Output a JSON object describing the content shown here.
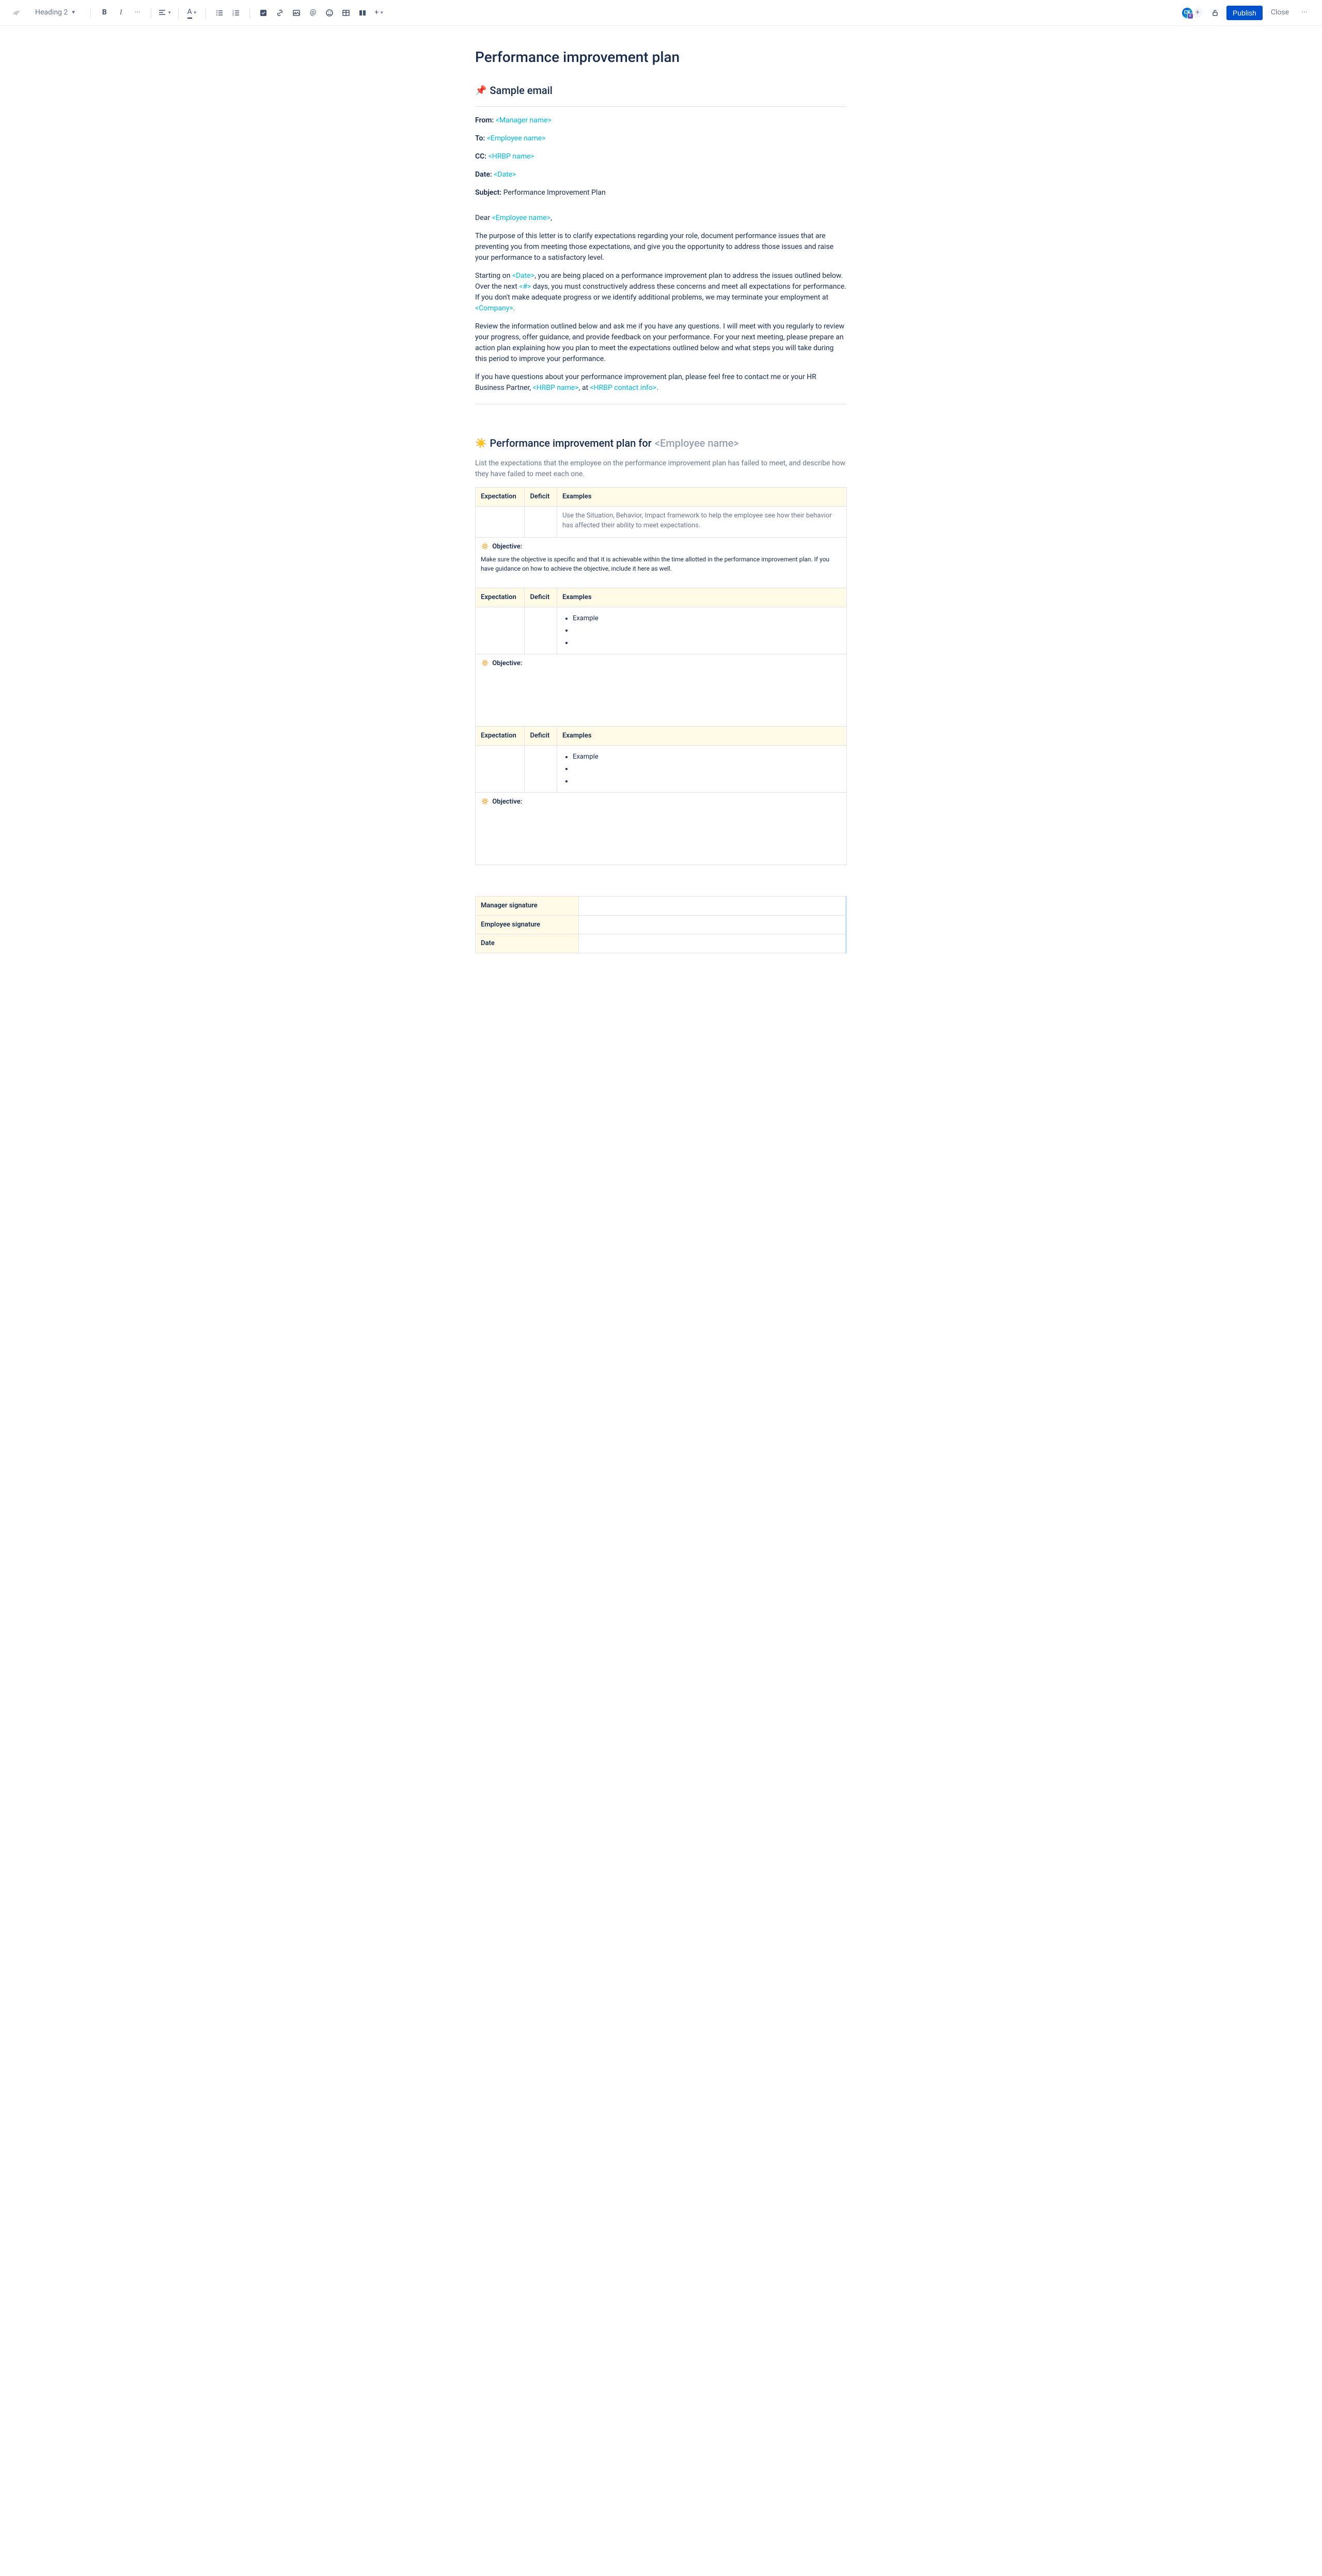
{
  "toolbar": {
    "style": "Heading 2",
    "publish": "Publish",
    "close": "Close",
    "avatar": "CK"
  },
  "title": "Performance improvement plan",
  "sample_email": {
    "heading": "Sample email",
    "from_label": "From:",
    "from_value": "<Manager name>",
    "to_label": "To:",
    "to_value": "<Employee name>",
    "cc_label": "CC:",
    "cc_value": "<HRBP name>",
    "date_label": "Date:",
    "date_value": "<Date>",
    "subject_label": "Subject:",
    "subject_value": "Performance Improvement Plan",
    "greeting_prefix": "Dear ",
    "greeting_name": "<Employee name>",
    "greeting_suffix": ",",
    "p1": "The purpose of this letter is to clarify expectations regarding your role, document performance issues that are preventing you from meeting those expectations, and give you the opportunity to address those issues and raise your performance to a satisfactory level.",
    "p2a": "Starting on ",
    "p2_date": "<Date>",
    "p2b": ", you are being placed on a performance improvement plan to address the issues outlined below. Over the next ",
    "p2_num": "<#>",
    "p2c": " days, you must constructively address these concerns and meet all expectations for performance. If you don't make adequate progress or we identify additional problems, we may terminate your employment at ",
    "p2_company": "<Company>",
    "p2d": ".",
    "p3": "Review the information outlined below and ask me if you have any questions. I will meet with you regularly to review your progress, offer guidance, and provide feedback on your performance. For your next meeting, please prepare an action plan explaining how you plan to meet the expectations outlined below and what steps you will take during this period to improve your performance.",
    "p4a": "If you have questions about your performance improvement plan, please feel free to contact me or your HR Business Partner, ",
    "p4_hrbp": "<HRBP name>",
    "p4b": ", at ",
    "p4_contact": "<HRBP contact info>",
    "p4c": "."
  },
  "pip": {
    "heading_prefix": "Performance improvement plan for ",
    "heading_name": "<Employee name>",
    "intro": "List the expectations that the employee on the performance improvement plan has failed to meet, and describe how they have failed to meet each one.",
    "th_expectation": "Expectation",
    "th_deficit": "Deficit",
    "th_examples": "Examples",
    "sbi": "Use the Situation, Behavior, Impact framework to help the employee see how their behavior has affected their ability to meet expectations.",
    "objective_label": "Objective:",
    "obj1_desc": "Make sure the objective is specific and that it is achievable within the time allotted in the performance improvement plan. If you have guidance on how to achieve the objective, include it here as well.",
    "example": "Example"
  },
  "sig": {
    "manager": "Manager signature",
    "employee": "Employee signature",
    "date": "Date"
  }
}
